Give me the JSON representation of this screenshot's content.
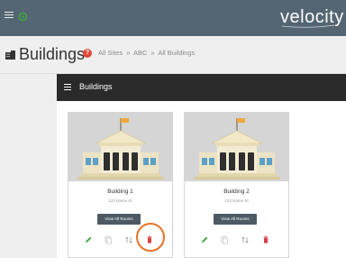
{
  "app": {
    "logo_text": "velocity",
    "accent_color": "#546673",
    "status_color": "#3ea63e"
  },
  "page": {
    "title": "Buildings",
    "breadcrumb": [
      "All Sites",
      "ABC",
      "All Buildings"
    ],
    "breadcrumb_separator": "»"
  },
  "panel": {
    "title": "Buildings"
  },
  "buildings": [
    {
      "name": "Building 1",
      "address": "123 Name St",
      "view_label": "View All Rooms"
    },
    {
      "name": "Building 2",
      "address": "123 Name St",
      "view_label": "View All Rooms"
    }
  ],
  "icons": {
    "menu": "menu-icon",
    "status": "status-icon",
    "building": "building-icon",
    "help": "help-icon",
    "edit": "pencil-icon",
    "copy": "copy-icon",
    "sort": "sort-icon",
    "delete": "trash-icon"
  },
  "help_glyph": "?"
}
